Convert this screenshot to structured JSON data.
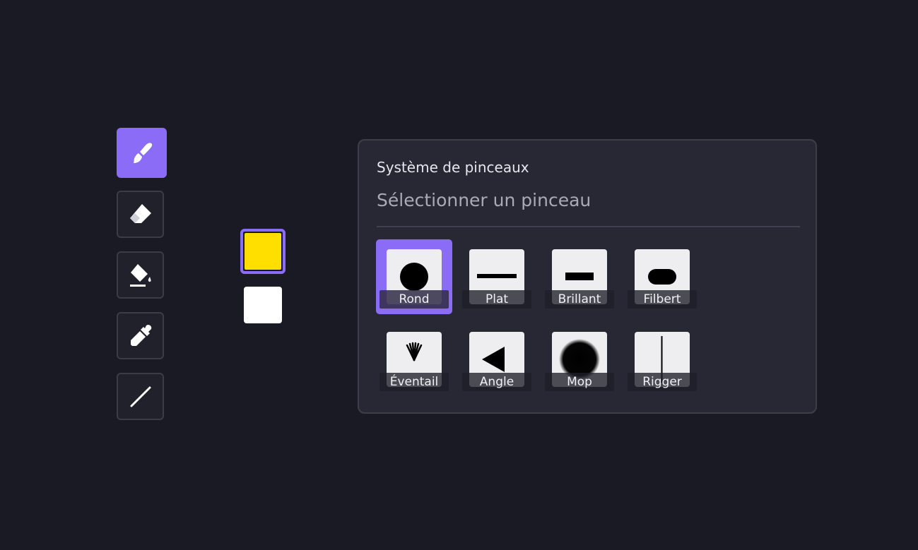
{
  "colors": {
    "accent": "#8b6cf6",
    "background": "#191a24",
    "panel": "#282835",
    "primary_color": "#ffdf00",
    "secondary_color": "#ffffff"
  },
  "toolbar": {
    "tools": [
      {
        "name": "brush",
        "icon": "paintbrush-icon",
        "active": true
      },
      {
        "name": "eraser",
        "icon": "eraser-icon",
        "active": false
      },
      {
        "name": "fill",
        "icon": "paint-bucket-icon",
        "active": false
      },
      {
        "name": "eyedropper",
        "icon": "eyedropper-icon",
        "active": false
      },
      {
        "name": "line",
        "icon": "line-icon",
        "active": false
      }
    ]
  },
  "panel": {
    "title": "Système de pinceaux",
    "subtitle": "Sélectionner un pinceau"
  },
  "brushes": [
    {
      "label": "Rond",
      "icon": "round-brush-icon",
      "selected": true
    },
    {
      "label": "Plat",
      "icon": "flat-brush-icon",
      "selected": false
    },
    {
      "label": "Brillant",
      "icon": "bright-brush-icon",
      "selected": false
    },
    {
      "label": "Filbert",
      "icon": "filbert-brush-icon",
      "selected": false
    },
    {
      "label": "Éventail",
      "icon": "fan-brush-icon",
      "selected": false
    },
    {
      "label": "Angle",
      "icon": "angle-brush-icon",
      "selected": false
    },
    {
      "label": "Mop",
      "icon": "mop-brush-icon",
      "selected": false
    },
    {
      "label": "Rigger",
      "icon": "rigger-brush-icon",
      "selected": false
    }
  ]
}
